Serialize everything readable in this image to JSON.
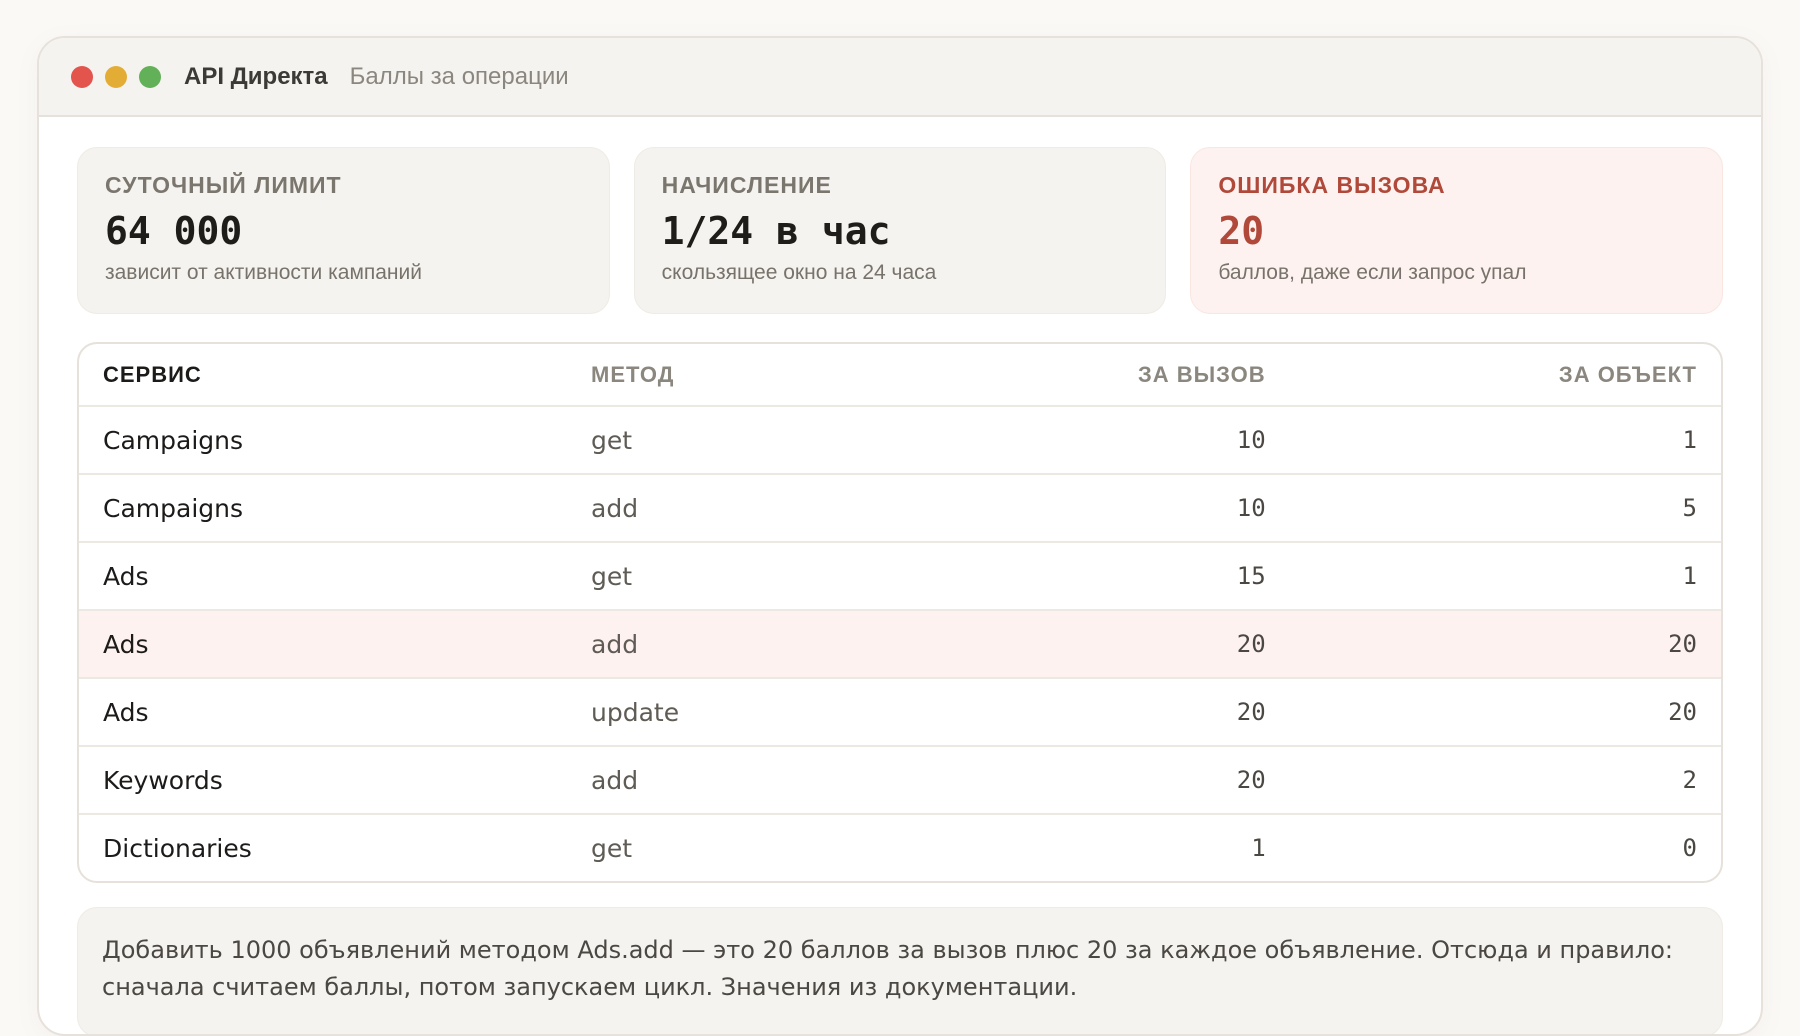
{
  "window": {
    "title": "API Директа",
    "subtitle": "Баллы за операции"
  },
  "cards": [
    {
      "label": "СУТОЧНЫЙ ЛИМИТ",
      "value": "64 000",
      "caption": "зависит от активности кампаний"
    },
    {
      "label": "НАЧИСЛЕНИЕ",
      "value": "1/24 в час",
      "caption": "скользящее окно на 24 часа"
    },
    {
      "label": "ОШИБКА ВЫЗОВА",
      "value": "20",
      "caption": "баллов, даже если запрос упал"
    }
  ],
  "table": {
    "headers": {
      "service": "СЕРВИС",
      "method": "МЕТОД",
      "per_call": "ЗА ВЫЗОВ",
      "per_object": "ЗА ОБЪЕКТ"
    },
    "rows": [
      {
        "service": "Campaigns",
        "method": "get",
        "per_call": "10",
        "per_object": "1"
      },
      {
        "service": "Campaigns",
        "method": "add",
        "per_call": "10",
        "per_object": "5"
      },
      {
        "service": "Ads",
        "method": "get",
        "per_call": "15",
        "per_object": "1"
      },
      {
        "service": "Ads",
        "method": "add",
        "per_call": "20",
        "per_object": "20"
      },
      {
        "service": "Ads",
        "method": "update",
        "per_call": "20",
        "per_object": "20"
      },
      {
        "service": "Keywords",
        "method": "add",
        "per_call": "20",
        "per_object": "2"
      },
      {
        "service": "Dictionaries",
        "method": "get",
        "per_call": "1",
        "per_object": "0"
      }
    ],
    "highlighted_row": "Ads add"
  },
  "note": "Добавить 1000 объявлений методом Ads.add — это 20 баллов за вызов плюс 20 за каждое объявление. Отсюда и правило: сначала считаем баллы, потом запускаем цикл. Значения из документации.",
  "colors": {
    "accent_alert": "#b0493a",
    "highlight_bg": "#fdf2ef",
    "dot_red": "#e2544c",
    "dot_yellow": "#e3ad35",
    "dot_green": "#62b058"
  }
}
